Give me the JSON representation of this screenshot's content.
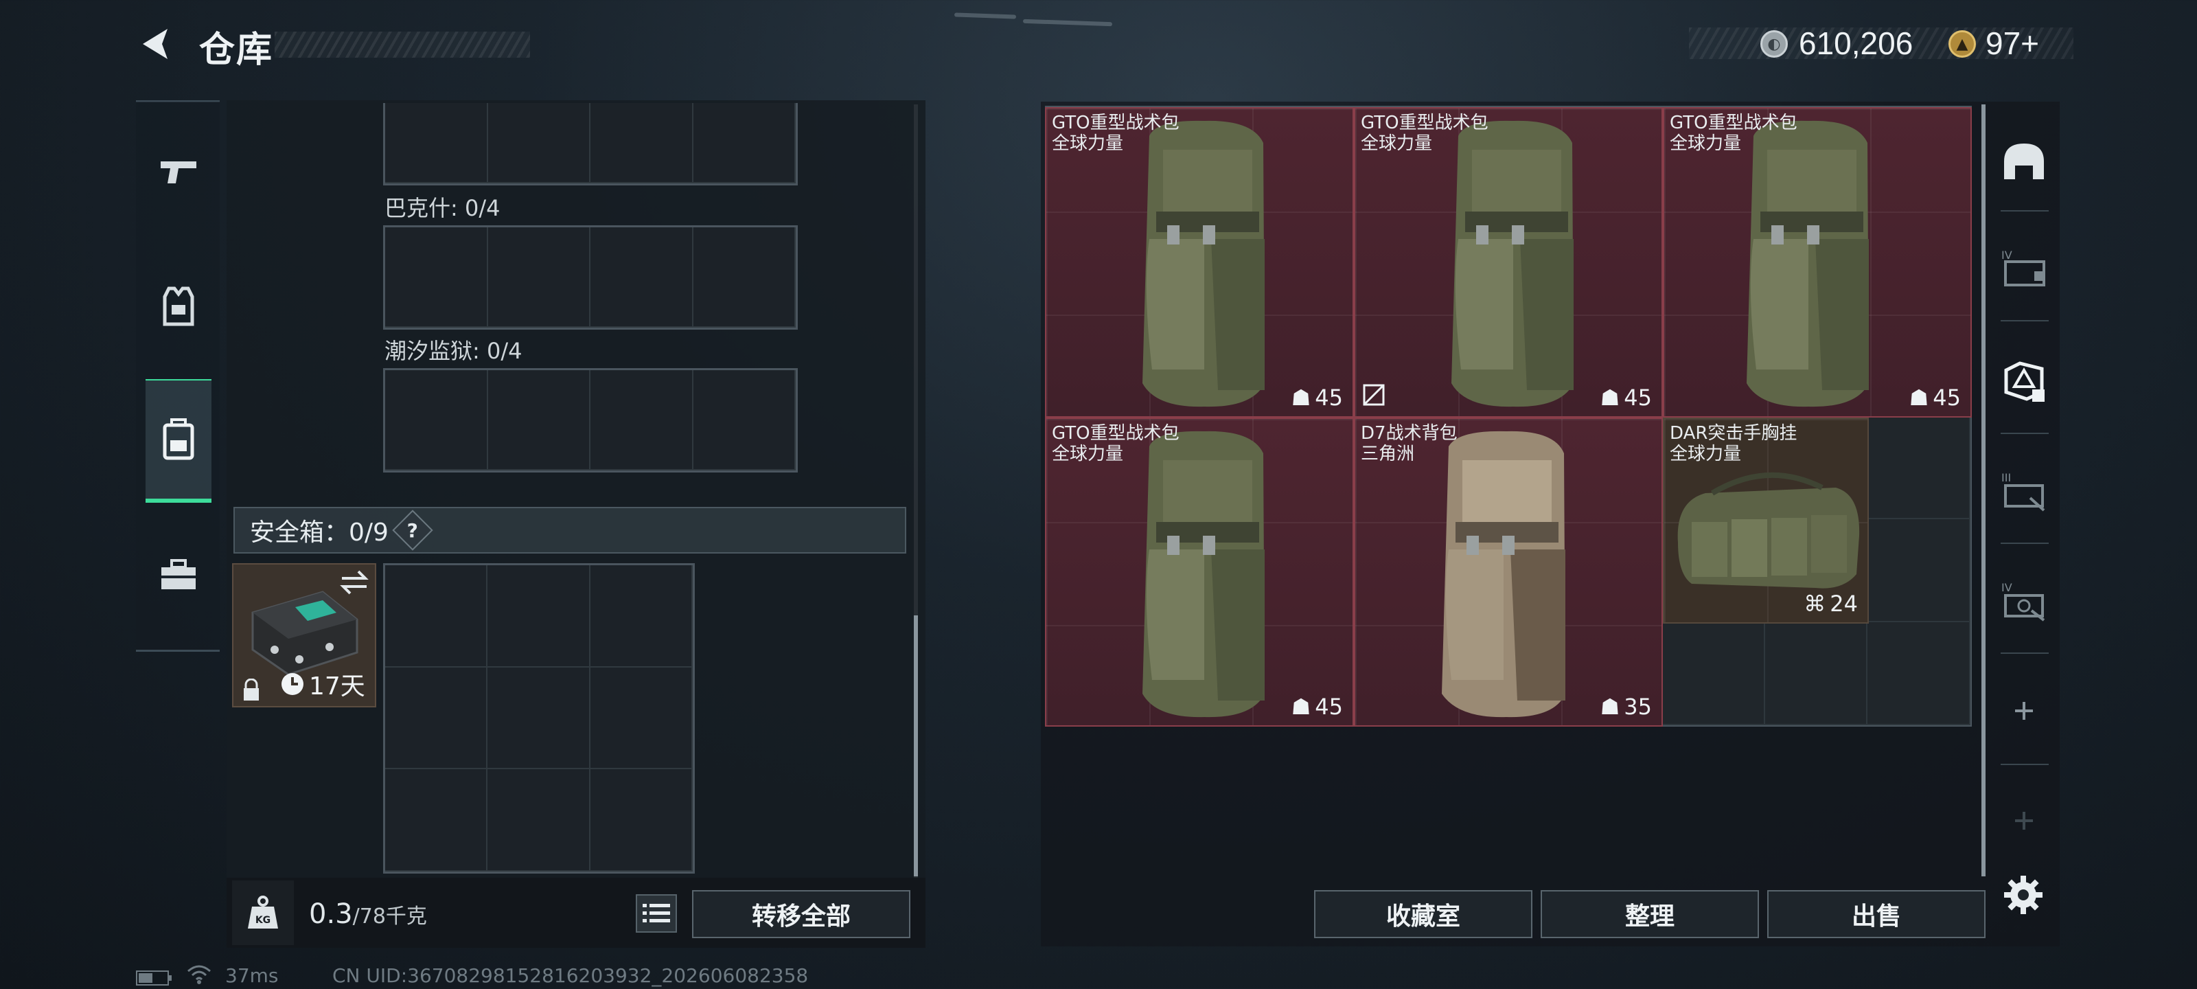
{
  "header": {
    "title": "仓库"
  },
  "currency": [
    {
      "icon": "silver-coin-icon",
      "value": "610,206"
    },
    {
      "icon": "gold-triangle-coin-icon",
      "value": "97",
      "suffix": "+"
    }
  ],
  "rail": [
    {
      "icon": "pistol-icon",
      "active": false
    },
    {
      "icon": "armor-vest-icon",
      "active": false
    },
    {
      "icon": "backpack-icon",
      "active": true
    },
    {
      "icon": "toolbox-icon",
      "active": false
    }
  ],
  "left": {
    "sections": [
      {
        "label": "巴克什: 0/4"
      },
      {
        "label": "潮汐监狱: 0/4"
      }
    ],
    "safebox": {
      "label": "安全箱：0/9",
      "help": "?",
      "time_left": "17天"
    },
    "weight": {
      "current": "0.3",
      "max": "/78千克"
    },
    "transfer_all": "转移全部"
  },
  "items": [
    {
      "name": "GTO重型战术包",
      "sub": "全球力量",
      "value": "45",
      "no_insurance": false
    },
    {
      "name": "GTO重型战术包",
      "sub": "全球力量",
      "value": "45",
      "no_insurance": true
    },
    {
      "name": "GTO重型战术包",
      "sub": "全球力量",
      "value": "45",
      "no_insurance": false
    },
    {
      "name": "GTO重型战术包",
      "sub": "全球力量",
      "value": "45",
      "no_insurance": false
    },
    {
      "name": "D7战术背包",
      "sub": "三角洲",
      "value": "35",
      "no_insurance": false
    },
    {
      "name": "DAR突击手胸挂",
      "sub": "全球力量",
      "value": "24",
      "no_insurance": false
    }
  ],
  "bottom_buttons": {
    "collection": "收藏室",
    "sort": "整理",
    "sell": "出售"
  },
  "status": {
    "ping": "37ms",
    "uid": "CN UID:36708298152816203932_202606082358"
  },
  "colors": {
    "accent": "#3ddc9b",
    "item_red": "#4e2530",
    "item_brown": "#3a3027"
  }
}
